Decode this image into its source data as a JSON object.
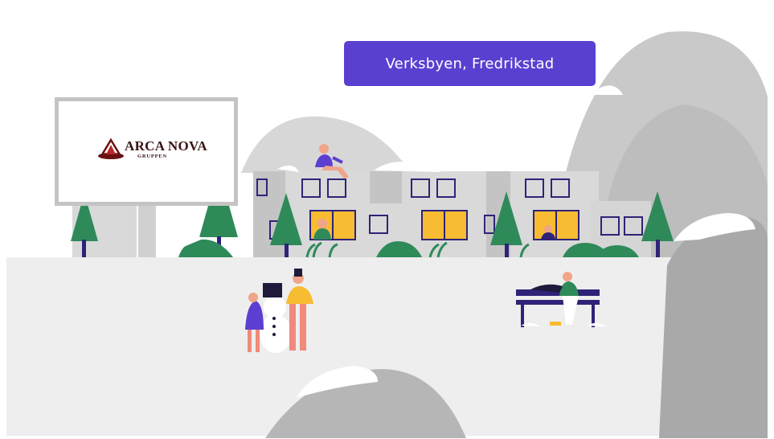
{
  "banner": {
    "location": "Verksbyen, Fredrikstad"
  },
  "logo": {
    "name": "ARCA NOVA",
    "tagline": "GRUPPEN"
  },
  "colors": {
    "banner_bg": "#5b3fd0",
    "mountain_gray": "#c8c8c8",
    "mountain_dark": "#9e9e9e",
    "building": "#d8d8d8",
    "window_lit": "#f8bc32",
    "window_frame": "#2e2378",
    "tree_green": "#2f8a5a",
    "ground": "#ededed"
  }
}
